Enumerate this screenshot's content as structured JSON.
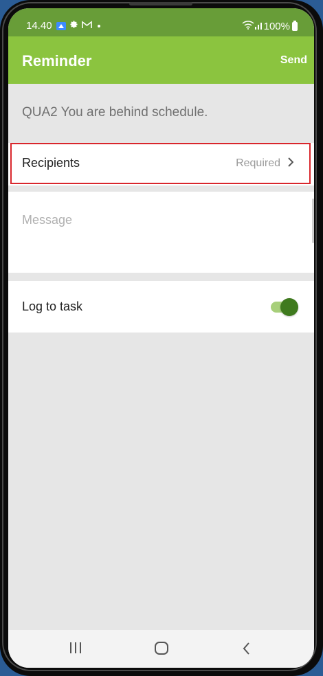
{
  "status_bar": {
    "time": "14.40",
    "battery": "100%",
    "icons": [
      "gallery-icon",
      "gear-icon",
      "gmail-icon",
      "dot-icon",
      "wifi-icon",
      "signal-icon",
      "battery-icon"
    ]
  },
  "app_bar": {
    "title": "Reminder",
    "send_label": "Send"
  },
  "subject": "QUA2 You are behind schedule.",
  "recipients": {
    "label": "Recipients",
    "status": "Required"
  },
  "message": {
    "placeholder": "Message"
  },
  "log_to_task": {
    "label": "Log to task",
    "enabled": true
  },
  "nav_bar": {
    "buttons": [
      "recent-apps-icon",
      "home-icon",
      "back-icon"
    ]
  },
  "colors": {
    "status_bar": "#689d38",
    "app_bar": "#8bc43f",
    "highlight": "#d9262c",
    "toggle_knob": "#3f7a1e",
    "background": "#e6e6e6"
  }
}
